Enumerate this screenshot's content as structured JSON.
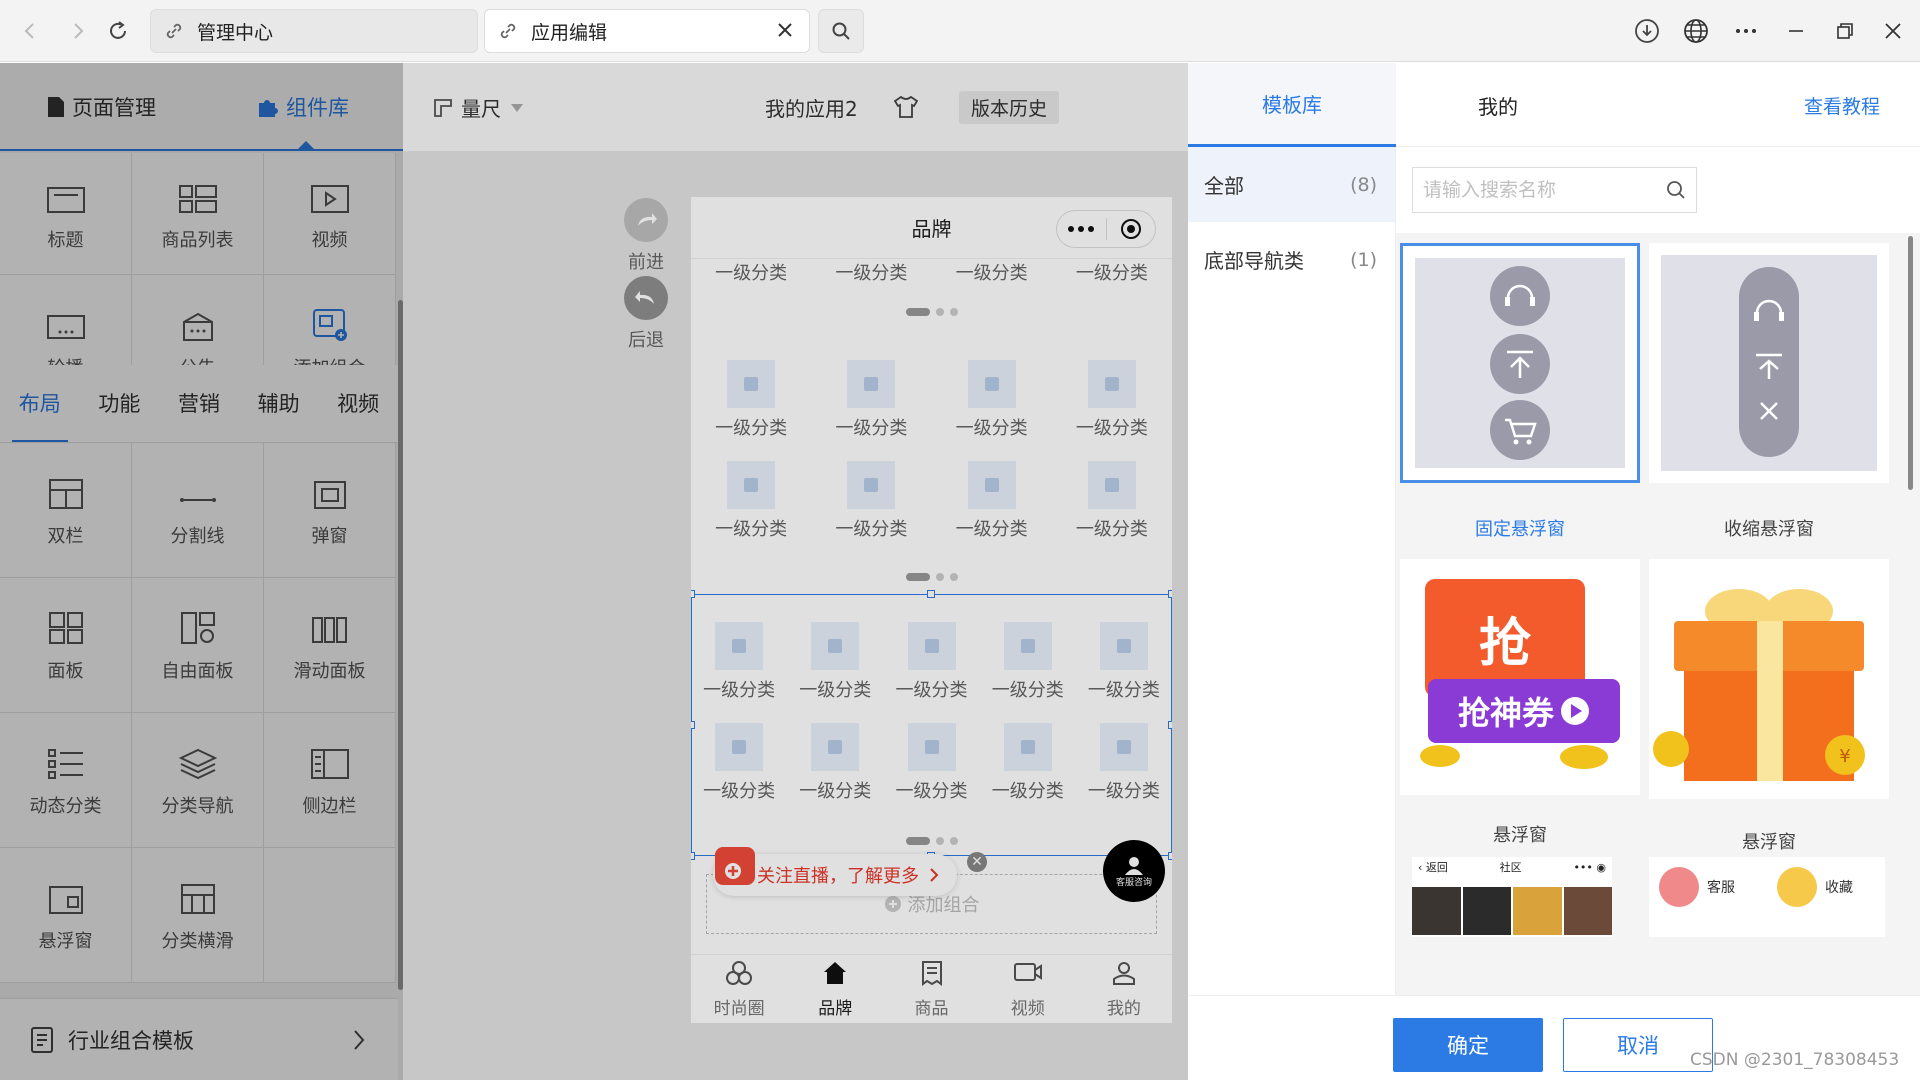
{
  "browser": {
    "tabs": [
      {
        "title": "管理中心"
      },
      {
        "title": "应用编辑"
      }
    ]
  },
  "left_panel": {
    "tabs": [
      "页面管理",
      "组件库"
    ],
    "basic_items": [
      "标题",
      "商品列表",
      "视频",
      "轮播",
      "公告",
      "添加组合"
    ],
    "category_tabs": [
      "布局",
      "功能",
      "营销",
      "辅助",
      "视频"
    ],
    "layout_items": [
      "双栏",
      "分割线",
      "弹窗",
      "面板",
      "自由面板",
      "滑动面板",
      "动态分类",
      "分类导航",
      "侧边栏",
      "悬浮窗",
      "分类横滑"
    ],
    "industry_template": "行业组合模板"
  },
  "editor": {
    "ruler": "量尺",
    "app_name": "我的应用2",
    "history": "版本历史",
    "forward": "前进",
    "back": "后退"
  },
  "phone": {
    "page_title": "品牌",
    "category_label": "一级分类",
    "add_combo": "添加组合",
    "live_banner": "关注直播，了解更多",
    "service": "客服咨询",
    "nav": [
      "时尚圈",
      "品牌",
      "商品",
      "视频",
      "我的"
    ]
  },
  "right_panel": {
    "tabs": {
      "library": "模板库",
      "mine": "我的",
      "tutorial": "查看教程"
    },
    "categories": [
      {
        "name": "全部",
        "count": "(8)"
      },
      {
        "name": "底部导航类",
        "count": "(1)"
      }
    ],
    "search_placeholder": "请输入搜索名称",
    "templates": [
      "固定悬浮窗",
      "收缩悬浮窗",
      "悬浮窗",
      "悬浮窗"
    ],
    "coupon_text_1": "抢",
    "coupon_text_2": "抢神券",
    "community_back": "返回",
    "community_title": "社区",
    "service_label": "客服",
    "favorite_label": "收藏",
    "confirm": "确定",
    "cancel": "取消"
  },
  "watermark": "CSDN @2301_78308453",
  "colors": {
    "accent": "#2c7be5",
    "live_red": "#e8392c"
  }
}
